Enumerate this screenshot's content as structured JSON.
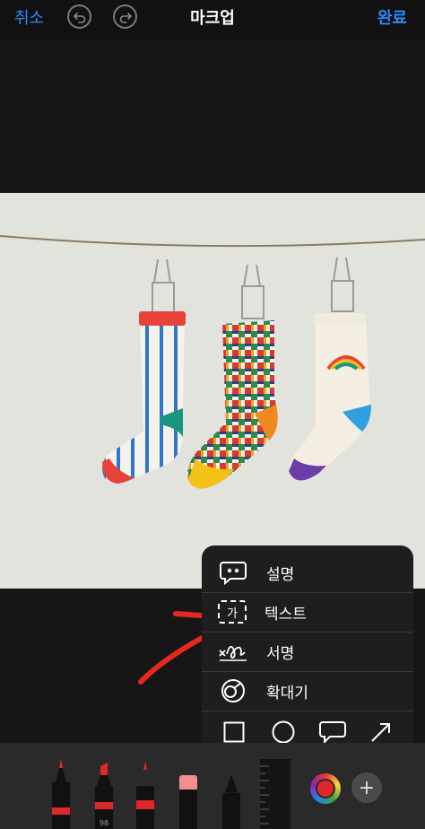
{
  "topbar": {
    "cancel_label": "취소",
    "title": "마크업",
    "done_label": "완료"
  },
  "menu": {
    "items": [
      {
        "label": "설명",
        "icon": "speech-bubble-quote-icon"
      },
      {
        "label": "텍스트",
        "icon": "text-box-icon",
        "icon_text": "가"
      },
      {
        "label": "서명",
        "icon": "signature-icon"
      },
      {
        "label": "확대기",
        "icon": "magnifier-icon"
      }
    ],
    "shapes": [
      "square-icon",
      "circle-icon",
      "speech-bubble-icon",
      "arrow-icon"
    ]
  },
  "toolbar": {
    "tools": [
      "pen-tool",
      "marker-tool",
      "pencil-tool",
      "eraser-tool",
      "lasso-tool",
      "ruler-tool"
    ],
    "marker_width_label": "98",
    "selected_color": "#e0282a",
    "plus_label": "+"
  },
  "colors": {
    "accent": "#2d8cff",
    "annotation": "#e8281e"
  }
}
